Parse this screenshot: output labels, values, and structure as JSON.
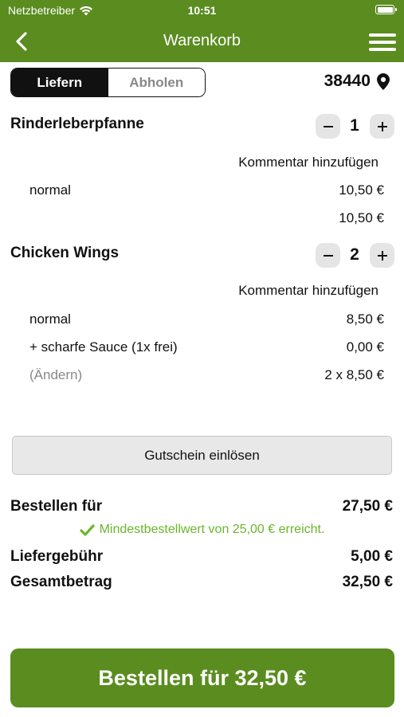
{
  "status_bar": {
    "carrier": "Netzbetreiber",
    "time": "10:51"
  },
  "nav": {
    "title": "Warenkorb"
  },
  "delivery_toggle": {
    "deliver": "Liefern",
    "pickup": "Abholen",
    "selected": "Liefern"
  },
  "postcode": "38440",
  "items": [
    {
      "name": "Rinderleberpfanne",
      "quantity": "1",
      "comment_link": "Kommentar hinzufügen",
      "lines": [
        {
          "label": "normal",
          "price": "10,50 €"
        }
      ],
      "total": "10,50 €"
    },
    {
      "name": "Chicken Wings",
      "quantity": "2",
      "comment_link": "Kommentar hinzufügen",
      "lines": [
        {
          "label": "normal",
          "price": "8,50 €"
        },
        {
          "label": "+ scharfe Sauce (1x frei)",
          "price": "0,00 €"
        },
        {
          "label": "(Ändern)",
          "price": "2 x 8,50 €"
        }
      ]
    }
  ],
  "coupon_button": "Gutschein einlösen",
  "summary": {
    "order_for_label": "Bestellen für",
    "order_for_value": "27,50 €",
    "minimum_notice": "Mindestbestellwert von 25,00 € erreicht.",
    "delivery_fee_label": "Liefergebühr",
    "delivery_fee_value": "5,00 €",
    "total_label": "Gesamtbetrag",
    "total_value": "32,50 €"
  },
  "order_button": "Bestellen für 32,50 €",
  "colors": {
    "brand_green": "#5a8c1f",
    "success_green": "#6cb52d"
  }
}
